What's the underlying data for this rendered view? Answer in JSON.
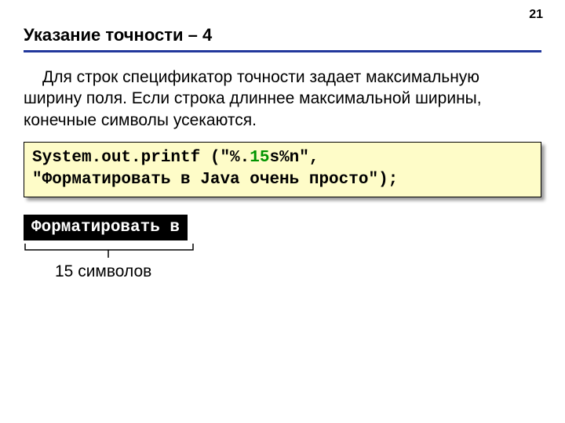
{
  "page_number": "21",
  "title": "Указание точности – 4",
  "paragraph": "Для строк спецификатор точности задает максимальную ширину поля. Если строка длиннее максимальной ширины, конечные символы усекаются.",
  "code": {
    "pre": "System.out.printf (\"%.",
    "highlight": "15",
    "post": "s%n\",",
    "line2": "\"Форматировать в Java очень просто\");"
  },
  "output": "Форматировать в",
  "caption": "15 символов"
}
